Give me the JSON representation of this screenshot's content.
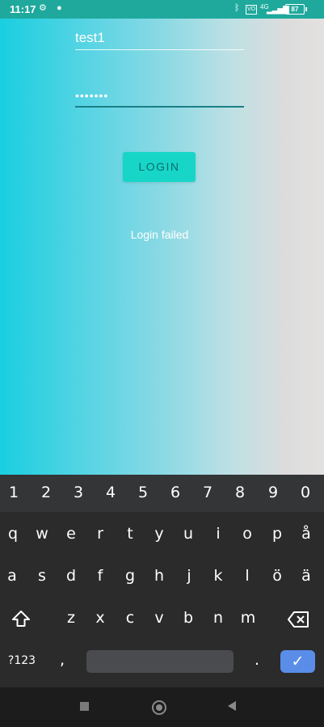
{
  "status_bar": {
    "time": "11:17",
    "battery": "87",
    "network": "4G"
  },
  "login_form": {
    "username_value": "test1",
    "password_value": "•••••••",
    "login_label": "LOGIN",
    "message": "Login failed"
  },
  "keyboard": {
    "number_row": [
      "1",
      "2",
      "3",
      "4",
      "5",
      "6",
      "7",
      "8",
      "9",
      "0"
    ],
    "row1": [
      "q",
      "w",
      "e",
      "r",
      "t",
      "y",
      "u",
      "i",
      "o",
      "p",
      "å"
    ],
    "row2": [
      "a",
      "s",
      "d",
      "f",
      "g",
      "h",
      "j",
      "k",
      "l",
      "ö",
      "ä"
    ],
    "row3": [
      "z",
      "x",
      "c",
      "v",
      "b",
      "n",
      "m"
    ],
    "symbols_label": "?123",
    "comma": ",",
    "period": ".",
    "shift_icon": "shift-icon",
    "backspace_icon": "backspace-icon",
    "enter_icon": "check-icon"
  },
  "nav_bar": {
    "recents_icon": "square-icon",
    "home_icon": "circle-icon",
    "back_icon": "triangle-back-icon"
  }
}
